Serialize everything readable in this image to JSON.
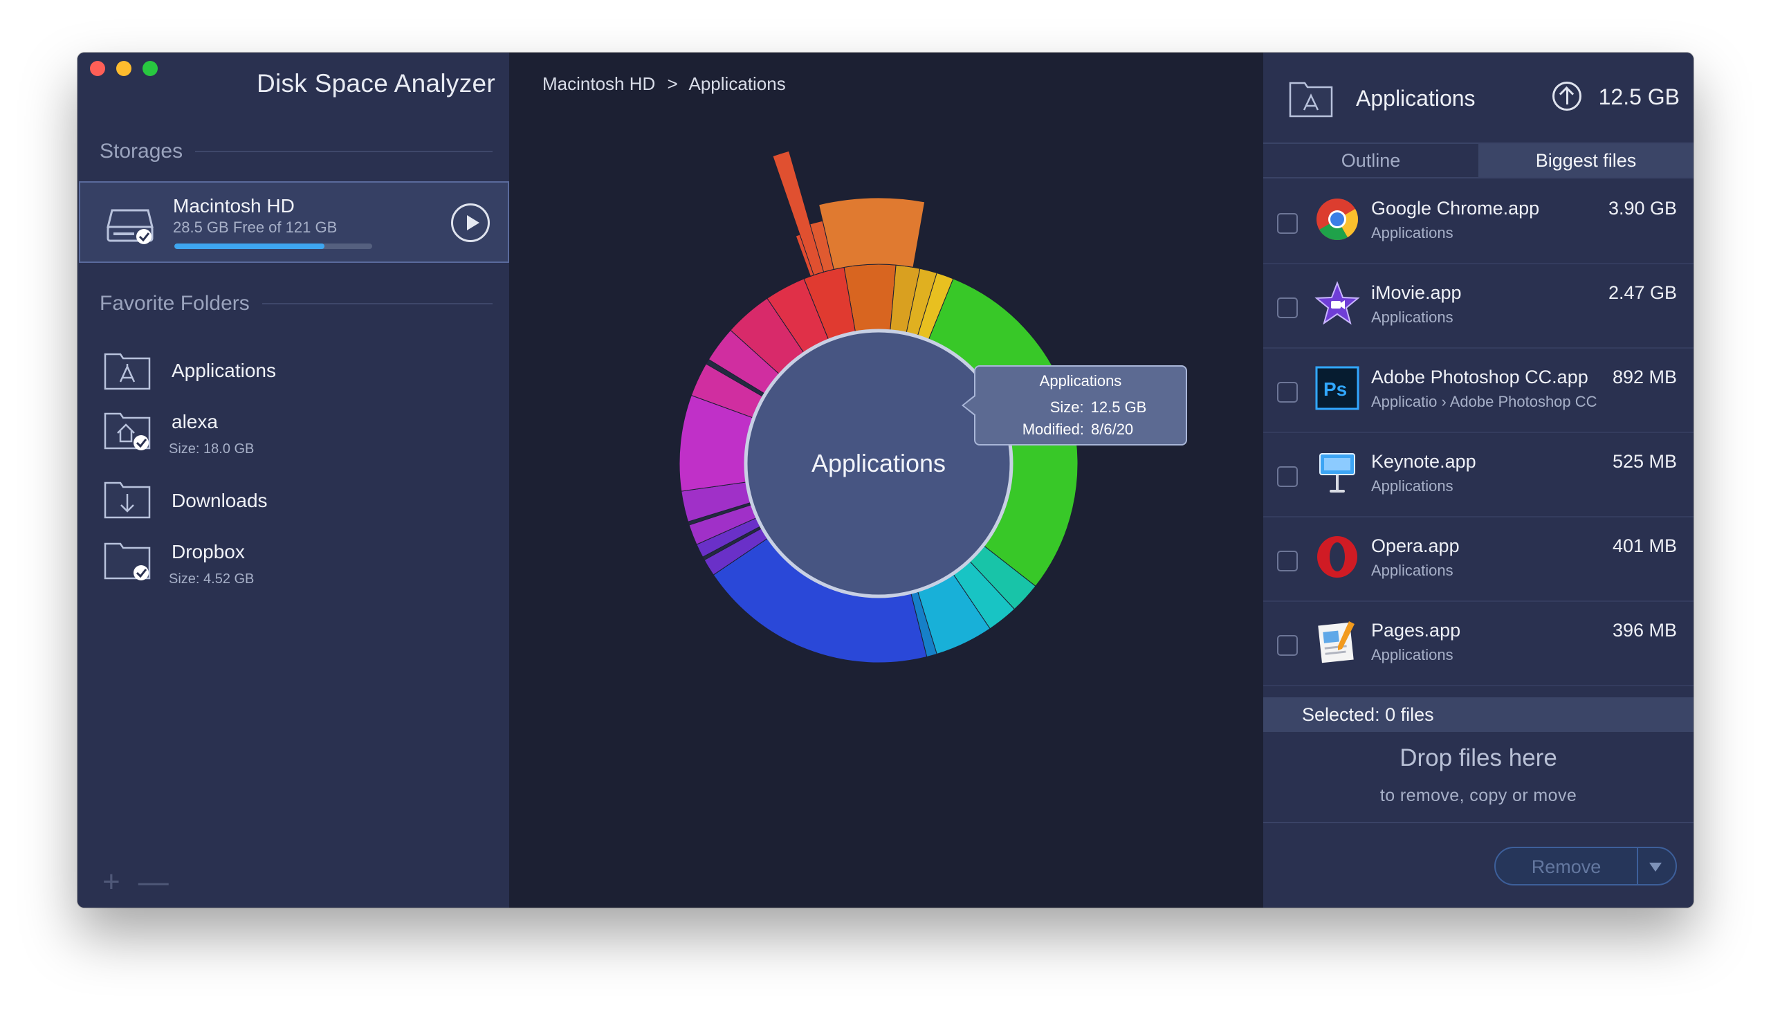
{
  "app": {
    "title": "Disk Space Analyzer",
    "window_controls": [
      "close",
      "minimize",
      "zoom"
    ]
  },
  "sidebar": {
    "storages_header": "Storages",
    "storage": {
      "name": "Macintosh HD",
      "free_text": "28.5 GB Free of 121 GB",
      "used_fraction": 0.76,
      "icon": "hard-drive-icon",
      "action_icon": "play-icon"
    },
    "favorites_header": "Favorite Folders",
    "favorites": [
      {
        "name": "Applications",
        "size": "",
        "icon": "applications-folder-icon"
      },
      {
        "name": "alexa",
        "size": "Size: 18.0 GB",
        "icon": "home-folder-icon"
      },
      {
        "name": "Downloads",
        "size": "",
        "icon": "downloads-folder-icon"
      },
      {
        "name": "Dropbox",
        "size": "Size: 4.52 GB",
        "icon": "folder-icon"
      }
    ],
    "bottom_add": "+",
    "bottom_remove": "—"
  },
  "breadcrumb": {
    "items": [
      "Macintosh HD",
      ">",
      "Applications"
    ]
  },
  "sunburst": {
    "center_label": "Applications",
    "tooltip": {
      "title": "Applications",
      "size_label": "Size:",
      "size_value": "12.5 GB",
      "modified_label": "Modified:",
      "modified_value": "8/6/20"
    },
    "colors": {
      "center": "#475582",
      "center_ring": "#c8d0e4"
    }
  },
  "right_panel": {
    "title": "Applications",
    "size": "12.5 GB",
    "folder_icon": "applications-folder-icon",
    "up_icon": "arrow-up-circle-icon",
    "tabs": [
      {
        "label": "Outline",
        "active": false
      },
      {
        "label": "Biggest files",
        "active": true
      }
    ],
    "files": [
      {
        "name": "Google Chrome.app",
        "path": "Applications",
        "size": "3.90 GB",
        "icon": "chrome-icon"
      },
      {
        "name": "iMovie.app",
        "path": "Applications",
        "size": "2.47 GB",
        "icon": "imovie-icon"
      },
      {
        "name": "Adobe Photoshop CC.app",
        "path": "Applicatio › Adobe Photoshop CC",
        "size": "892 MB",
        "icon": "photoshop-icon"
      },
      {
        "name": "Keynote.app",
        "path": "Applications",
        "size": "525 MB",
        "icon": "keynote-icon"
      },
      {
        "name": "Opera.app",
        "path": "Applications",
        "size": "401 MB",
        "icon": "opera-icon"
      },
      {
        "name": "Pages.app",
        "path": "Applications",
        "size": "396 MB",
        "icon": "pages-icon"
      }
    ],
    "selected_text": "Selected: 0 files",
    "drop_title": "Drop files here",
    "drop_sub": "to remove, copy or move",
    "remove_label": "Remove"
  }
}
